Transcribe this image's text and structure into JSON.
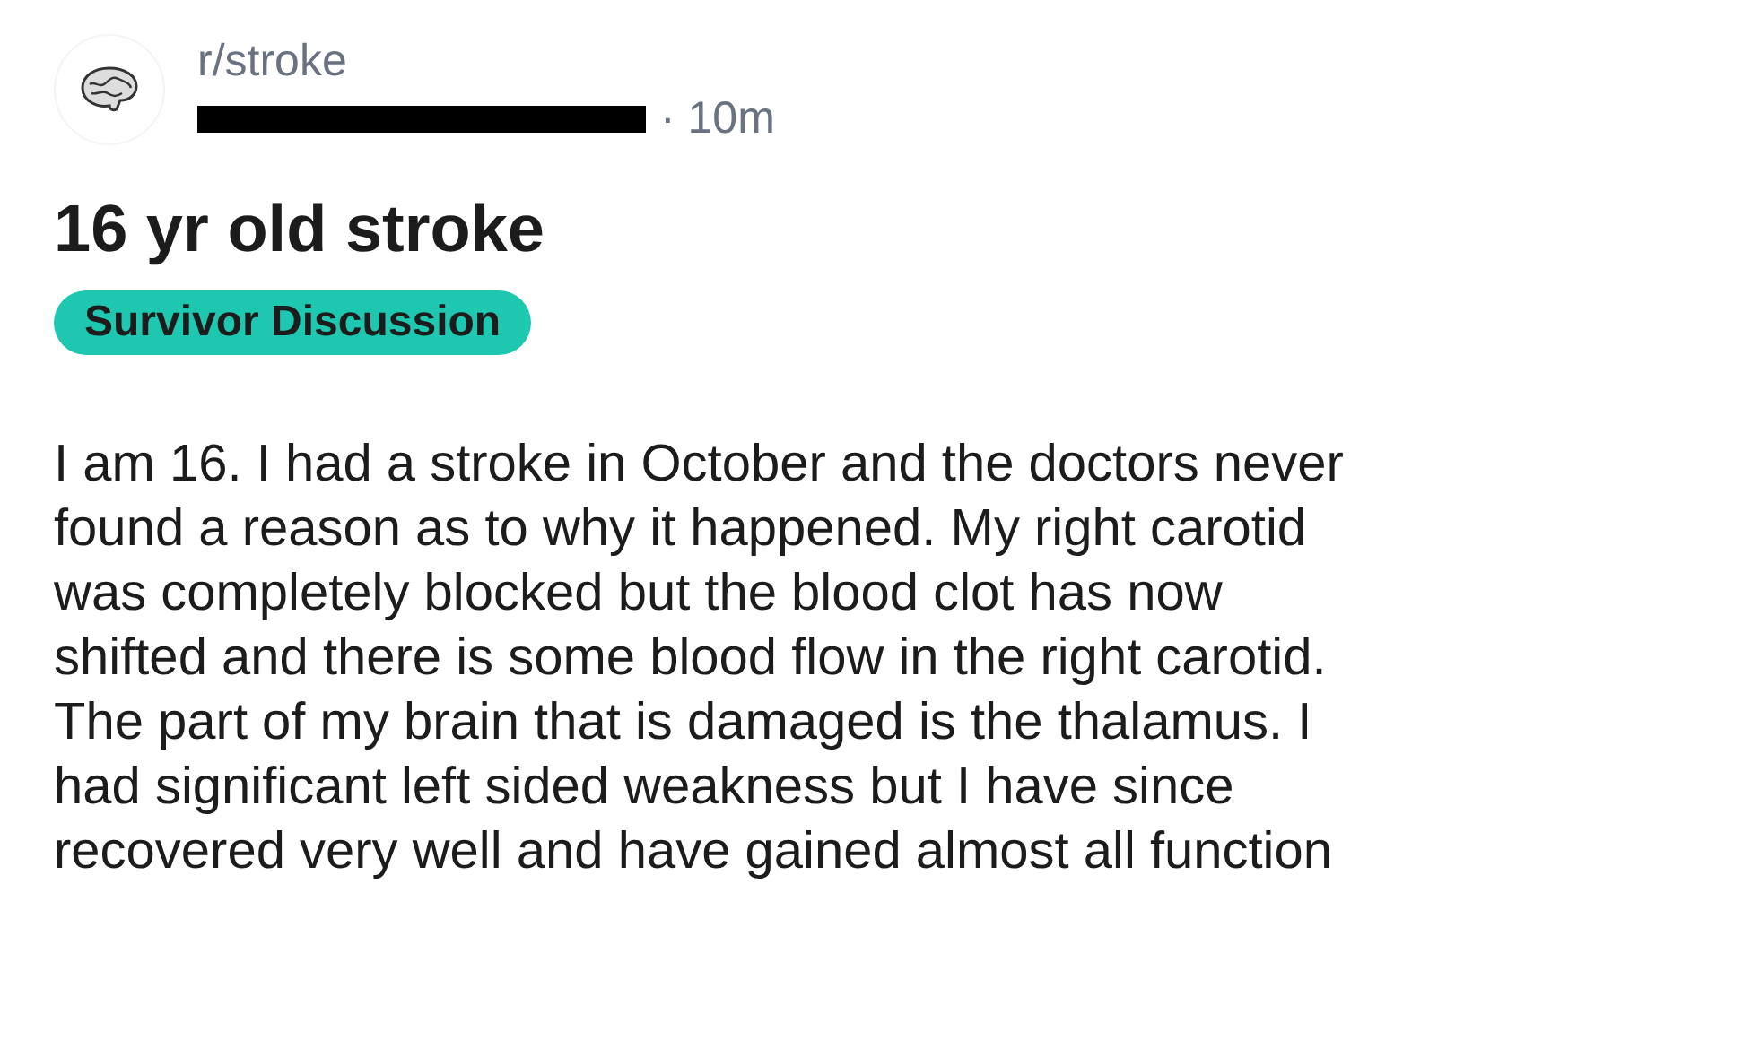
{
  "post": {
    "subreddit": "r/stroke",
    "age": "· 10m",
    "title": "16 yr old stroke",
    "flair": "Survivor Discussion",
    "body_lines": [
      "I am 16. I had a stroke in October and the doctors never",
      "found a reason as to why it happened. My right carotid",
      "was completely blocked but the blood clot has now",
      "shifted and there is some blood flow in the right carotid.",
      "The part of my brain that is damaged is the thalamus. I",
      "had significant left sided weakness but I have since",
      "recovered very well and have gained almost all function"
    ]
  }
}
